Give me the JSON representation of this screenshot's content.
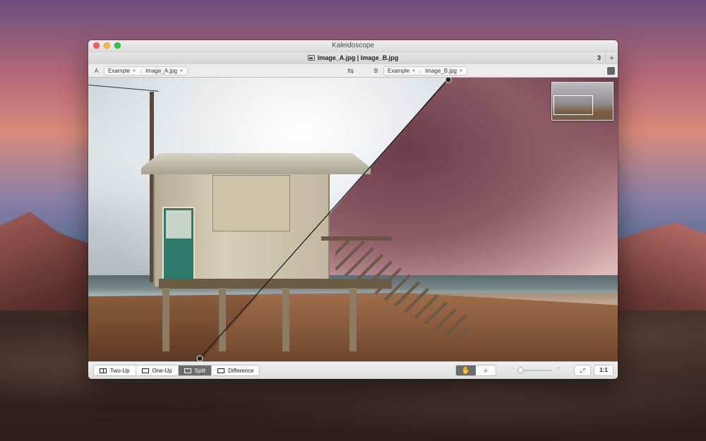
{
  "window": {
    "title": "Kaleidoscope"
  },
  "tab": {
    "title": "Image_A.jpg | Image_B.jpg",
    "count": "3",
    "add_label": "+"
  },
  "side_a": {
    "letter": "A",
    "folder": "Example",
    "file": "Image_A.jpg"
  },
  "side_b": {
    "letter": "B",
    "folder": "Example",
    "file": "Image_B.jpg"
  },
  "swap_icon": "⇆",
  "modes": [
    {
      "label": "Two-Up",
      "icon": "two-up-icon"
    },
    {
      "label": "One-Up",
      "icon": "one-up-icon"
    },
    {
      "label": "Split",
      "icon": "split-icon",
      "active": true
    },
    {
      "label": "Difference",
      "icon": "difference-icon"
    }
  ],
  "tools": {
    "pan": "✋",
    "zoom": "⌕"
  },
  "zoom": {
    "minus": "−",
    "plus": "+",
    "level": 0.08
  },
  "fit_glyph": "⤢",
  "actual_size_label": "1:1",
  "colors": {
    "active_segment": "#6c6c6c",
    "window_chrome": "#ececec"
  }
}
